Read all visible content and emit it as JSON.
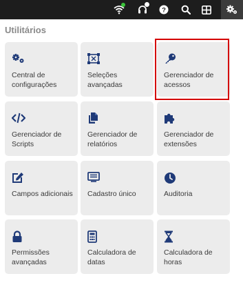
{
  "topbar": {
    "icons": [
      "wifi-icon",
      "headset-icon",
      "help-icon",
      "search-icon",
      "grid-icon",
      "gears-icon"
    ],
    "status_dot_color": "#3ac43a",
    "notification_dot_color": "#ffffff"
  },
  "section": {
    "title": "Utilitários",
    "tiles": [
      {
        "label": "Central de configurações",
        "icon": "gears-icon"
      },
      {
        "label": "Seleções avançadas",
        "icon": "selection-icon"
      },
      {
        "label": "Gerenciador de acessos",
        "icon": "key-icon"
      },
      {
        "label": "Gerenciador de Scripts",
        "icon": "code-icon"
      },
      {
        "label": "Gerenciador de relatórios",
        "icon": "copy-icon"
      },
      {
        "label": "Gerenciador de extensões",
        "icon": "puzzle-icon"
      },
      {
        "label": "Campos adicionais",
        "icon": "edit-icon"
      },
      {
        "label": "Cadastro único",
        "icon": "id-card-icon"
      },
      {
        "label": "Auditoria",
        "icon": "clock-icon"
      },
      {
        "label": "Permissões avançadas",
        "icon": "lock-icon"
      },
      {
        "label": "Calculadora de datas",
        "icon": "calculator-icon"
      },
      {
        "label": "Calculadora de horas",
        "icon": "hourglass-icon"
      }
    ]
  },
  "colors": {
    "icon": "#1f3a78",
    "tile_bg": "#ececec",
    "highlight": "#d40000"
  }
}
